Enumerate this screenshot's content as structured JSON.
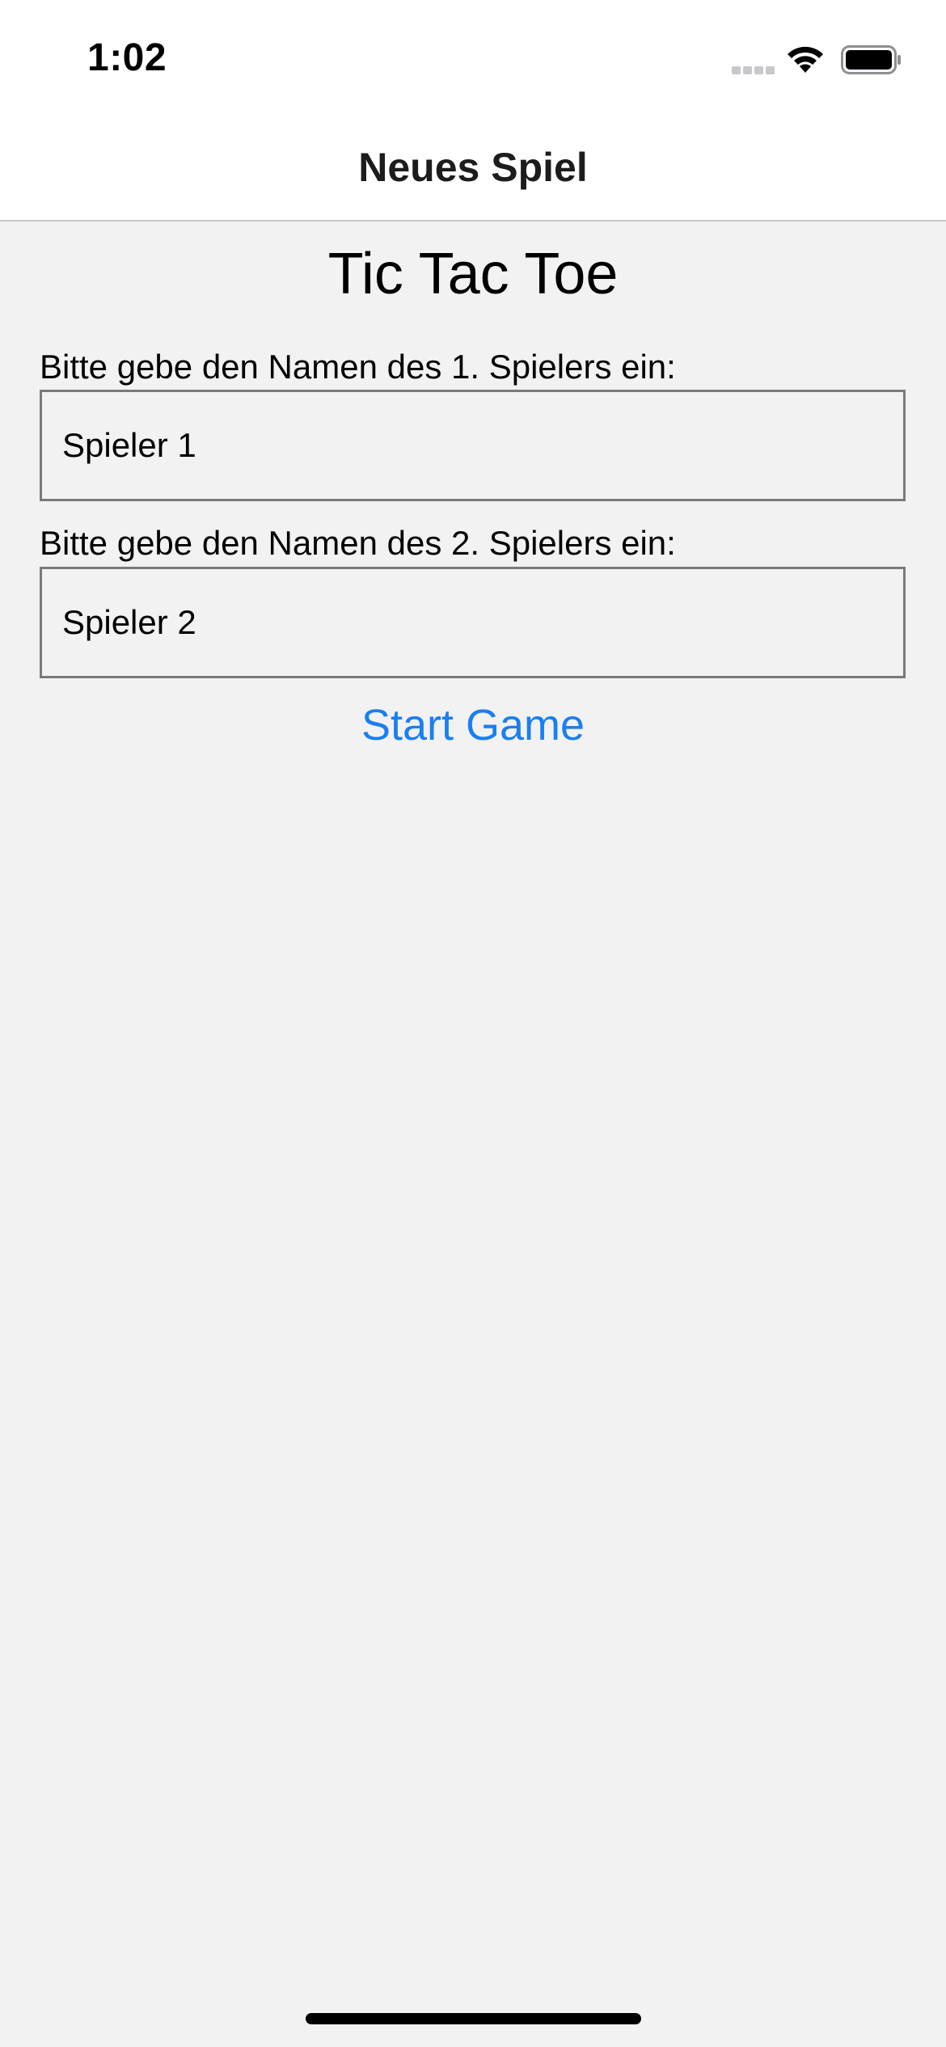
{
  "status_bar": {
    "time": "1:02",
    "icons": [
      "signal-icon",
      "wifi-icon",
      "battery-icon"
    ]
  },
  "nav": {
    "title": "Neues Spiel"
  },
  "main": {
    "title": "Tic Tac Toe",
    "player1": {
      "label": "Bitte gebe den Namen des 1. Spielers ein:",
      "value": "Spieler 1"
    },
    "player2": {
      "label": "Bitte gebe den Namen des 2. Spielers ein:",
      "value": "Spieler 2"
    },
    "start_button": "Start Game"
  },
  "colors": {
    "background": "#f2f2f2",
    "accent": "#1a7ff0",
    "field_border": "#7a7a7a"
  }
}
